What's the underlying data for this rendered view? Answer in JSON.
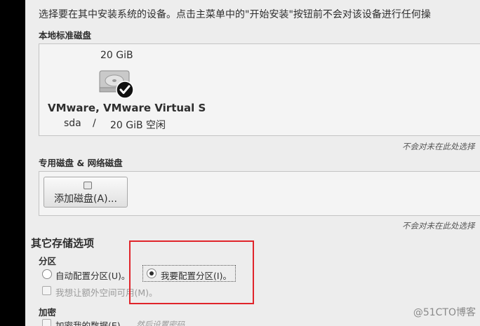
{
  "intro_text": "选择要在其中安装系统的设备。点击主菜单中的\"开始安装\"按钮前不会对该设备进行任何操",
  "local_disks": {
    "title": "本地标准磁盘",
    "disk": {
      "size": "20 GiB",
      "name": "VMware, VMware Virtual S",
      "device": "sda",
      "separator": "/",
      "free": "20 GiB 空闲",
      "icon": "hard-disk-icon",
      "selected": true
    },
    "note": "不会对未在此处选择"
  },
  "special_disks": {
    "title": "专用磁盘 & 网络磁盘",
    "add_button_label": "添加磁盘(A)...",
    "note": "不会对未在此处选择"
  },
  "other_options": {
    "title": "其它存储选项",
    "partition": {
      "title": "分区",
      "auto_label": "自动配置分区(U)。",
      "manual_label": "我要配置分区(I)。",
      "selected": "manual",
      "extra_space_label": "我想让额外空间可用(M)。"
    },
    "encryption": {
      "title": "加密",
      "encrypt_label": "加密我的数据(E)",
      "passphrase_hint": "然后设置密码"
    }
  },
  "watermark": "@51CTO博客",
  "colors": {
    "highlight": "#e0242a",
    "panel_bg": "#ededed"
  }
}
